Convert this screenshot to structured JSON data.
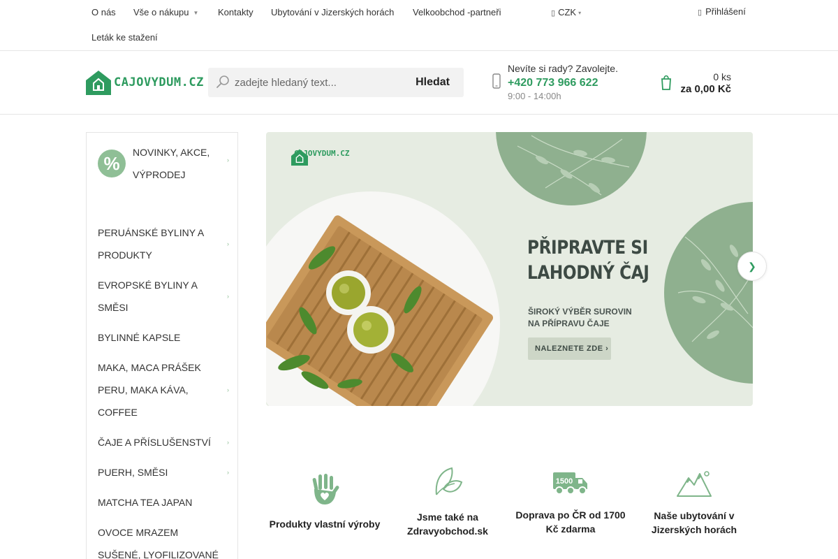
{
  "topnav": {
    "items": [
      "O nás",
      "Vše o nákupu",
      "Kontakty",
      "Ubytování v Jizerských horách",
      "Velkoobchod -partneři",
      "Leták ke stažení"
    ],
    "currency": "CZK",
    "login": "Přihlášení"
  },
  "header": {
    "logo_text": "CAJOVYDUM.CZ",
    "search_placeholder": "zadejte hledaný text...",
    "search_button": "Hledat",
    "help_text": "Nevíte si rady? Zavolejte.",
    "phone": "+420 773 966 622",
    "hours": "9:00 - 14:00h",
    "cart_count": "0 ks",
    "cart_total": "za 0,00 Kč"
  },
  "sidebar": {
    "promo_icon_text": "%",
    "promo_label": "NOVINKY, AKCE, VÝPRODEJ",
    "categories": [
      {
        "label": "PERUÁNSKÉ BYLINY A PRODUKTY",
        "has_sub": true
      },
      {
        "label": "EVROPSKÉ BYLINY A SMĚSI",
        "has_sub": true
      },
      {
        "label": "BYLINNÉ KAPSLE",
        "has_sub": false
      },
      {
        "label": "MAKA, MACA PRÁŠEK PERU, MAKA KÁVA, COFFEE",
        "has_sub": true
      },
      {
        "label": "ČAJE A PŘÍSLUŠENSTVÍ",
        "has_sub": true
      },
      {
        "label": "PUERH, SMĚSI",
        "has_sub": true
      },
      {
        "label": "MATCHA TEA JAPAN",
        "has_sub": false
      },
      {
        "label": "OVOCE MRAZEM SUŠENÉ, LYOFILIZOVANÉ",
        "has_sub": false
      }
    ]
  },
  "banner": {
    "logo_text": "CAJOVYDUM.CZ",
    "headline_1": "PŘIPRAVTE SI",
    "headline_2": "LAHODNÝ ČAJ",
    "sub_1": "ŠIROKÝ VÝBĚR SUROVIN",
    "sub_2": "NA PŘÍPRAVU ČAJE",
    "cta": "NALEZNETE ZDE ›"
  },
  "benefits": [
    {
      "label": "Produkty vlastní výroby",
      "icon": "hand-heart-icon"
    },
    {
      "label": "Jsme také na Zdravyobchod.sk",
      "icon": "leaf-icon"
    },
    {
      "label": "Doprava po ČR od 1700 Kč zdarma",
      "icon": "truck-icon",
      "icon_text": "1500"
    },
    {
      "label": "Naše ubytování v Jizerských horách",
      "icon": "mountains-icon"
    }
  ],
  "colors": {
    "brand_green": "#2e9b5f",
    "soft_green": "#8fbf96",
    "banner_bg": "#e6ece2"
  }
}
